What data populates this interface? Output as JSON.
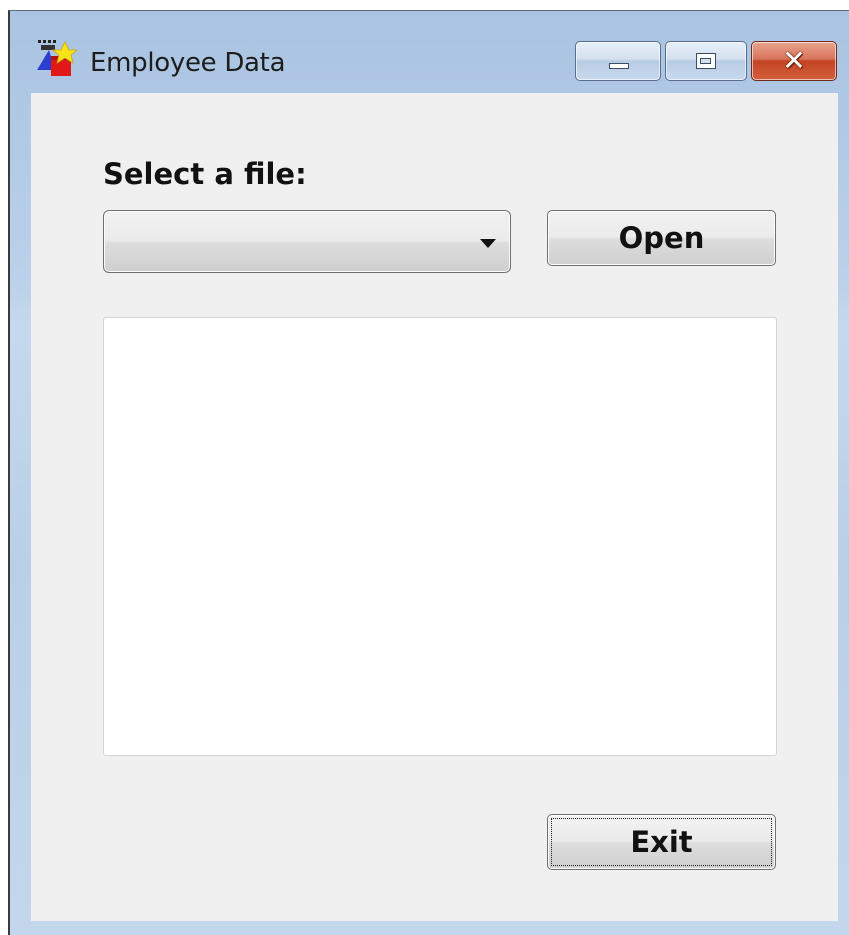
{
  "window": {
    "title": "Employee Data",
    "app_icon": "employee-data-app-icon",
    "caption_buttons": {
      "minimize_icon": "minimize-icon",
      "maximize_icon": "maximize-icon",
      "close_icon": "close-icon",
      "close_glyph": "✕"
    }
  },
  "form": {
    "select_label": "Select a file:",
    "file_combo": {
      "value": "",
      "arrow_icon": "chevron-down-icon"
    },
    "open_button": "Open",
    "file_list_items": [],
    "exit_button": "Exit"
  },
  "colors": {
    "client_background": "#f0f0f0",
    "close_button": "#c34422",
    "frame": "#b9cfe8"
  }
}
